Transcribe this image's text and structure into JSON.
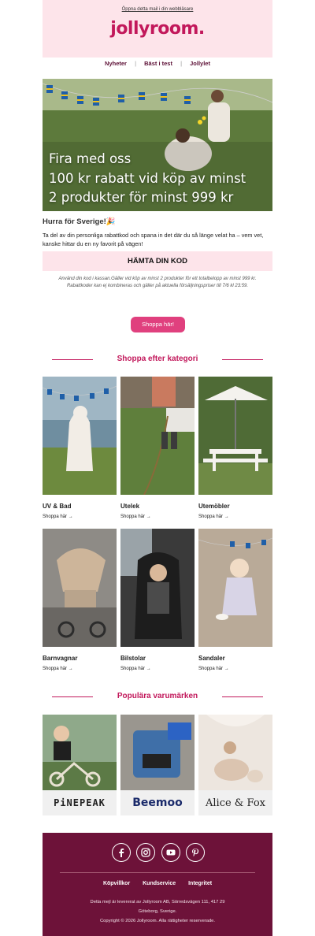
{
  "header": {
    "browser_link": "Öppna detta mail i din webbläsare",
    "logo": "jollyroom."
  },
  "nav": {
    "items": [
      "Nyheter",
      "Bäst i test",
      "Jollylet"
    ],
    "separator": "|"
  },
  "hero": {
    "lines": [
      "Fira med oss",
      "100 kr rabatt vid köp av minst",
      "2 produkter för minst 999 kr"
    ]
  },
  "intro": {
    "greeting": "Hurra för Sverige!🎉",
    "text": "Ta del av din personliga rabattkod och spana in det där du så länge velat ha – vem vet, kanske hittar du en ny favorit på vägen!"
  },
  "code_button": "HÄMTA DIN KOD",
  "terms": "Använd din kod i kassan.Gäller vid köp av minst 2 produkter för ett totalbelopp av minst 999 kr. Rabattkoder kan ej kombineras och gäller på aktuella försäljningspriser till 7/6 kl 23:59.",
  "cta": "Shoppa här!",
  "categories": {
    "title": "Shoppa efter kategori",
    "items": [
      {
        "name": "UV & Bad",
        "link": "Shoppa här →"
      },
      {
        "name": "Utelek",
        "link": "Shoppa här →"
      },
      {
        "name": "Utemöbler",
        "link": "Shoppa här →"
      },
      {
        "name": "Barnvagnar",
        "link": "Shoppa här →"
      },
      {
        "name": "Bilstolar",
        "link": "Shoppa här →"
      },
      {
        "name": "Sandaler",
        "link": "Shoppa här →"
      }
    ]
  },
  "brands": {
    "title": "Populära varumärken",
    "items": [
      "PiNEPEAK",
      "Beemoo",
      "Alice & Fox"
    ]
  },
  "footer": {
    "social_icons": [
      "facebook-icon",
      "instagram-icon",
      "youtube-icon",
      "pinterest-icon"
    ],
    "links": [
      "Köpvillkor",
      "Kundservice",
      "Integritet"
    ],
    "info_lines": [
      "Detta mejl är levererat av Jollyroom AB, Sörredsvägen 111, 417 29",
      "Göteborg, Sverige.",
      "Copyright © 2026 Jollyroom. Alla rättigheter reserverade."
    ]
  },
  "colors": {
    "brand": "#c2185b",
    "footer_bg": "#6d1239",
    "pink_bg": "#fde4ea",
    "cta": "#e0407e"
  }
}
